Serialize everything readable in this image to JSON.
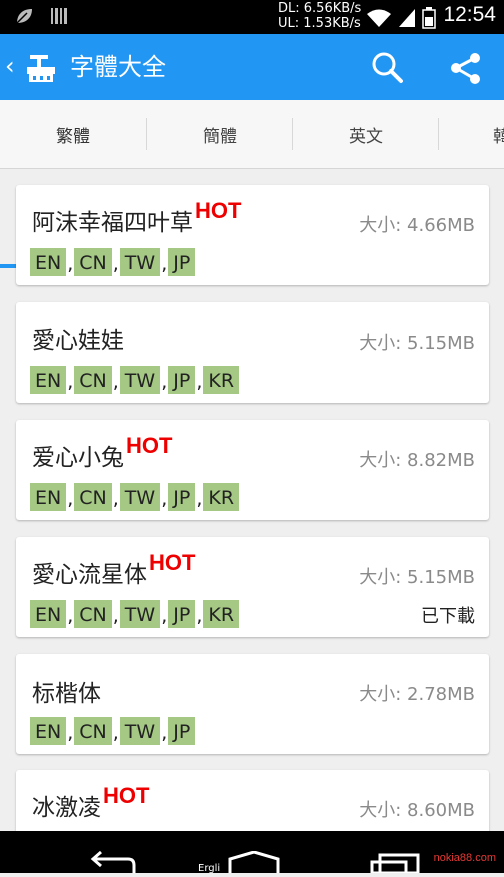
{
  "status": {
    "net_dl": "DL: 6.56KB/s",
    "net_ul": "UL: 1.53KB/s",
    "time": "12:54"
  },
  "app": {
    "back": "‹",
    "title": "字體大全"
  },
  "tabs": [
    {
      "label": "繁體",
      "active": true
    },
    {
      "label": "簡體",
      "active": false
    },
    {
      "label": "英文",
      "active": false
    },
    {
      "label": "韓",
      "active": false
    }
  ],
  "fonts": [
    {
      "name": "阿沫幸福四叶草",
      "hot": "HOT",
      "size": "大小: 4.66MB",
      "langs": [
        "EN",
        "CN",
        "TW",
        "JP"
      ],
      "downloaded": ""
    },
    {
      "name": "愛心娃娃",
      "hot": "",
      "size": "大小: 5.15MB",
      "langs": [
        "EN",
        "CN",
        "TW",
        "JP",
        "KR"
      ],
      "downloaded": ""
    },
    {
      "name": "爱心小兔",
      "hot": "HOT",
      "size": "大小: 8.82MB",
      "langs": [
        "EN",
        "CN",
        "TW",
        "JP",
        "KR"
      ],
      "downloaded": ""
    },
    {
      "name": "愛心流星体",
      "hot": "HOT",
      "size": "大小: 5.15MB",
      "langs": [
        "EN",
        "CN",
        "TW",
        "JP",
        "KR"
      ],
      "downloaded": "已下載"
    },
    {
      "name": "标楷体",
      "hot": "",
      "size": "大小: 2.78MB",
      "langs": [
        "EN",
        "CN",
        "TW",
        "JP"
      ],
      "downloaded": ""
    },
    {
      "name": "冰激凌",
      "hot": "HOT",
      "size": "大小: 8.60MB",
      "langs": [],
      "downloaded": ""
    }
  ],
  "nav": {
    "label": "Ergli",
    "watermark": "nokia88.com"
  }
}
